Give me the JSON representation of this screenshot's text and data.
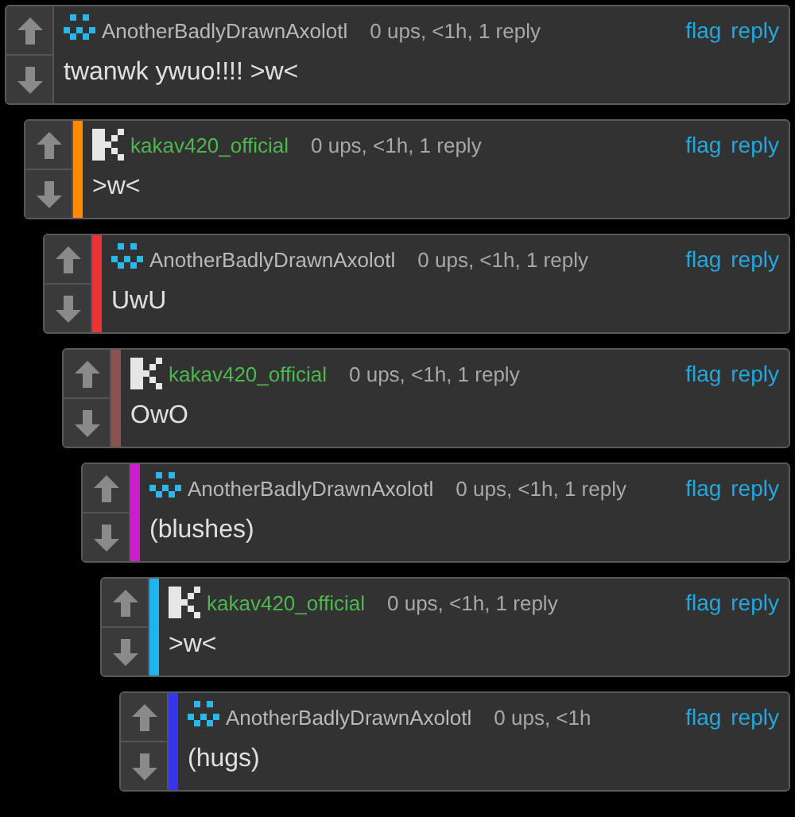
{
  "comments": [
    {
      "kind": "axolotl",
      "user": "AnotherBadlyDrawnAxolotl",
      "meta": "0 ups, <1h, 1 reply",
      "actions": [
        "flag",
        "reply"
      ],
      "body": "twanwk ywuo!!!! >w<",
      "children": [
        {
          "kind": "official",
          "color": "#ff8c00",
          "user": "kakav420_official",
          "meta": "0 ups, <1h, 1 reply",
          "actions": [
            "flag",
            "reply"
          ],
          "body": ">w<",
          "children": [
            {
              "kind": "axolotl",
              "color": "#ee3333",
              "user": "AnotherBadlyDrawnAxolotl",
              "meta": "0 ups, <1h, 1 reply",
              "actions": [
                "flag",
                "reply"
              ],
              "body": "UwU",
              "children": [
                {
                  "kind": "official",
                  "color": "#8b5252",
                  "user": "kakav420_official",
                  "meta": "0 ups, <1h, 1 reply",
                  "actions": [
                    "flag",
                    "reply"
                  ],
                  "body": "OwO",
                  "children": [
                    {
                      "kind": "axolotl",
                      "color": "#cc1fcc",
                      "user": "AnotherBadlyDrawnAxolotl",
                      "meta": "0 ups, <1h, 1 reply",
                      "actions": [
                        "flag",
                        "reply"
                      ],
                      "body": "(blushes)",
                      "children": [
                        {
                          "kind": "official",
                          "color": "#1fb4ee",
                          "user": "kakav420_official",
                          "meta": "0 ups, <1h, 1 reply",
                          "actions": [
                            "flag",
                            "reply"
                          ],
                          "body": ">w<",
                          "children": [
                            {
                              "kind": "axolotl",
                              "color": "#3535ee",
                              "user": "AnotherBadlyDrawnAxolotl",
                              "meta": "0 ups, <1h",
                              "actions": [
                                "flag",
                                "reply"
                              ],
                              "body": "(hugs)"
                            }
                          ]
                        }
                      ]
                    }
                  ]
                }
              ]
            }
          ]
        }
      ]
    }
  ]
}
